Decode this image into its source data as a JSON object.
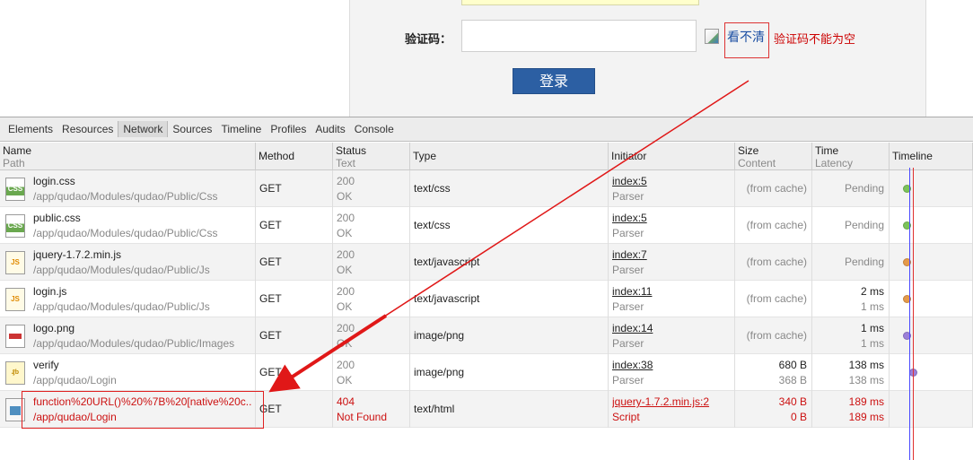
{
  "login_form": {
    "captcha_label": "验证码：",
    "captcha_value": "",
    "refresh_link": "看不清",
    "captcha_error": "验证码不能为空",
    "login_button": "登录"
  },
  "devtools": {
    "tabs": [
      {
        "label": "Elements",
        "active": false
      },
      {
        "label": "Resources",
        "active": false
      },
      {
        "label": "Network",
        "active": true
      },
      {
        "label": "Sources",
        "active": false
      },
      {
        "label": "Timeline",
        "active": false
      },
      {
        "label": "Profiles",
        "active": false
      },
      {
        "label": "Audits",
        "active": false
      },
      {
        "label": "Console",
        "active": false
      }
    ],
    "columns": {
      "name": "Name",
      "path": "Path",
      "method": "Method",
      "status": "Status",
      "text": "Text",
      "type": "Type",
      "initiator": "Initiator",
      "size": "Size",
      "content": "Content",
      "time": "Time",
      "latency": "Latency",
      "timeline": "Timeline"
    },
    "requests": [
      {
        "icon": "css-file-icon",
        "name": "login.css",
        "path": "/app/qudao/Modules/qudao/Public/Css",
        "method": "GET",
        "status": "200",
        "status_text": "OK",
        "type": "text/css",
        "initiator": "index:5",
        "initiator_type": "Parser",
        "size": "(from cache)",
        "content": "",
        "time": "Pending",
        "latency": "",
        "dot_color": "#7cc35a"
      },
      {
        "icon": "css-file-icon",
        "name": "public.css",
        "path": "/app/qudao/Modules/qudao/Public/Css",
        "method": "GET",
        "status": "200",
        "status_text": "OK",
        "type": "text/css",
        "initiator": "index:5",
        "initiator_type": "Parser",
        "size": "(from cache)",
        "content": "",
        "time": "Pending",
        "latency": "",
        "dot_color": "#7cc35a"
      },
      {
        "icon": "js-file-icon",
        "name": "jquery-1.7.2.min.js",
        "path": "/app/qudao/Modules/qudao/Public/Js",
        "method": "GET",
        "status": "200",
        "status_text": "OK",
        "type": "text/javascript",
        "initiator": "index:7",
        "initiator_type": "Parser",
        "size": "(from cache)",
        "content": "",
        "time": "Pending",
        "latency": "",
        "dot_color": "#e59a4a"
      },
      {
        "icon": "js-file-icon",
        "name": "login.js",
        "path": "/app/qudao/Modules/qudao/Public/Js",
        "method": "GET",
        "status": "200",
        "status_text": "OK",
        "type": "text/javascript",
        "initiator": "index:11",
        "initiator_type": "Parser",
        "size": "(from cache)",
        "content": "",
        "time": "2 ms",
        "latency": "1 ms",
        "dot_color": "#e59a4a"
      },
      {
        "icon": "image-file-icon",
        "name": "logo.png",
        "path": "/app/qudao/Modules/qudao/Public/Images",
        "method": "GET",
        "status": "200",
        "status_text": "OK",
        "type": "image/png",
        "initiator": "index:14",
        "initiator_type": "Parser",
        "size": "(from cache)",
        "content": "",
        "time": "1 ms",
        "latency": "1 ms",
        "dot_color": "#9b7fd8"
      },
      {
        "icon": "verify-image-icon",
        "name": "verify",
        "path": "/app/qudao/Login",
        "method": "GET",
        "status": "200",
        "status_text": "OK",
        "type": "image/png",
        "initiator": "index:38",
        "initiator_type": "Parser",
        "size": "680 B",
        "content": "368 B",
        "time": "138 ms",
        "latency": "138 ms",
        "dot_color": "#9b7fd8"
      },
      {
        "icon": "document-file-icon",
        "name": "function%20URL()%20%7B%20[native%20c...",
        "path": "/app/qudao/Login",
        "method": "GET",
        "status": "404",
        "status_text": "Not Found",
        "type": "text/html",
        "initiator": "jquery-1.7.2.min.js:2",
        "initiator_type": "Script",
        "size": "340 B",
        "content": "0 B",
        "time": "189 ms",
        "latency": "189 ms",
        "dot_color": "",
        "error": true
      }
    ]
  }
}
